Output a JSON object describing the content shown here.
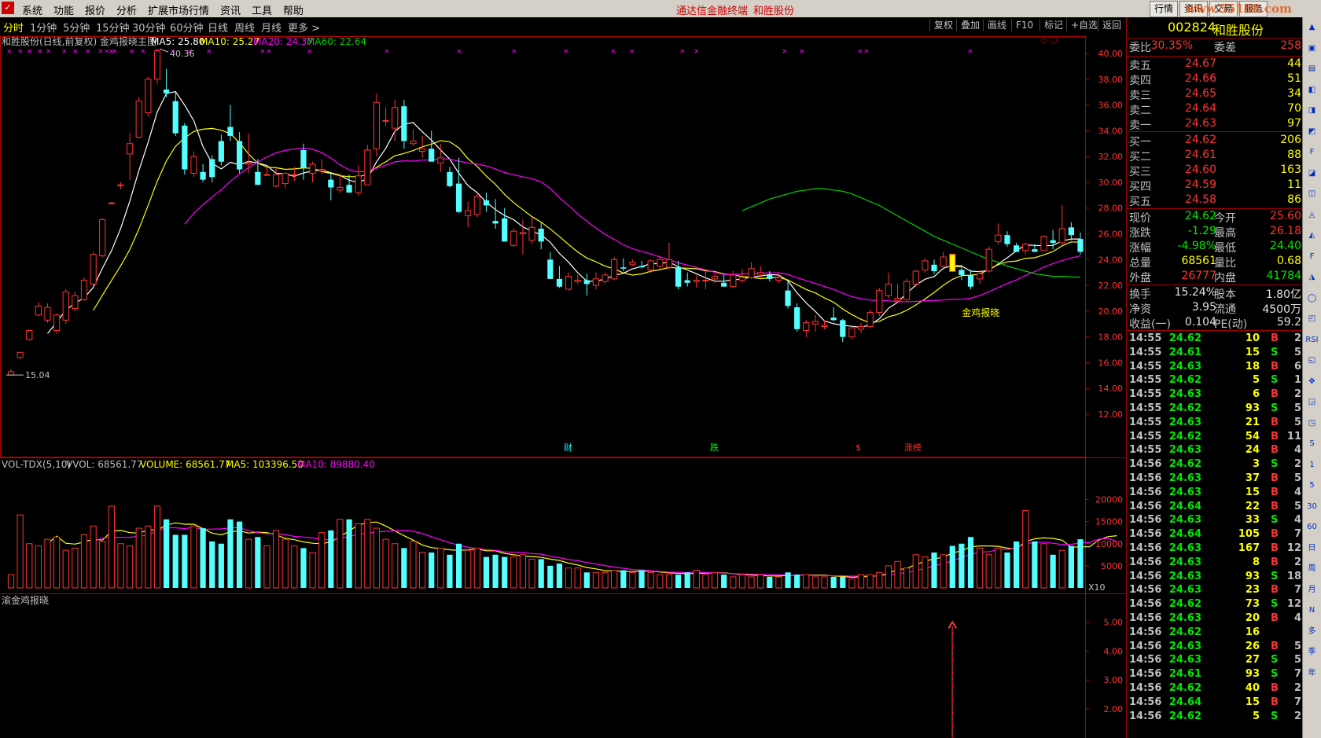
{
  "menubar": {
    "logo": "✓",
    "items": [
      "系统",
      "功能",
      "报价",
      "分析",
      "扩展市场行情",
      "资讯",
      "工具",
      "帮助"
    ],
    "center_app": "通达信金融终端",
    "center_stock": "和胜股份",
    "right_buttons": [
      "行情",
      "资讯",
      "交易",
      "服务"
    ],
    "watermark": "www.55188.com"
  },
  "tabs": {
    "periods": [
      "分时",
      "1分钟",
      "5分钟",
      "15分钟",
      "30分钟",
      "60分钟",
      "日线",
      "周线",
      "月线",
      "更多 >"
    ],
    "active": "日线",
    "tools": [
      "复权",
      "叠加",
      "画线",
      "F10",
      "标记",
      "+自选",
      "返回"
    ]
  },
  "kline": {
    "info_title": "和胜股份(日线,前复权) 金鸡报晓主图",
    "ma5": "MA5: 25.80",
    "ma10": "MA10: 25.27",
    "ma20": "MA20: 24.37",
    "ma60": "MA60: 22.64",
    "high_label": "40.36",
    "low_label": "15.04",
    "signal_label": "金鸡报晓",
    "event_labels": [
      "财",
      "跌",
      "$",
      "涨榜"
    ],
    "colors": {
      "up": "#ff3232",
      "down": "#54ffff",
      "ma5": "#ffffff",
      "ma10": "#ffff00",
      "ma20": "#ff00ff",
      "ma60": "#00d000",
      "signal": "#ffff00"
    }
  },
  "volume": {
    "title": "VOL-TDX(5,10)",
    "vvol": "VVOL: 68561.77",
    "volume": "VOLUME: 68561.77",
    "ma5": "MA5: 103396.50",
    "ma10": "MA10: 89880.40",
    "unit": "X10",
    "axis_labels": [
      "20000",
      "15000",
      "10000",
      "5000"
    ]
  },
  "indicator": {
    "title": "渝金鸡报晓",
    "axis_labels": [
      "5.00",
      "4.00",
      "3.00",
      "2.00"
    ]
  },
  "price_axis": [
    "40.00",
    "38.00",
    "36.00",
    "34.00",
    "32.00",
    "30.00",
    "28.00",
    "26.00",
    "24.00",
    "22.00",
    "20.00",
    "18.00",
    "16.00",
    "14.00",
    "12.00"
  ],
  "chart_data": [
    {
      "type": "candlestick",
      "title": "和胜股份(日线,前复权) 金鸡报晓主图",
      "y_range": [
        12,
        40.5
      ],
      "ohlc": [
        [
          15.04,
          15.5,
          15.04,
          15.3
        ],
        [
          16.4,
          16.8,
          16.3,
          16.8
        ],
        [
          17.8,
          18.5,
          17.7,
          18.5
        ],
        [
          19.7,
          20.7,
          19.6,
          20.4
        ],
        [
          19.3,
          20.6,
          19.1,
          20.3
        ],
        [
          18.5,
          19.8,
          18.3,
          19.7
        ],
        [
          19.3,
          21.7,
          19.0,
          21.5
        ],
        [
          20.2,
          21.5,
          20.0,
          21.2
        ],
        [
          20.9,
          22.6,
          20.8,
          22.4
        ],
        [
          22.1,
          24.6,
          22.0,
          24.4
        ],
        [
          24.3,
          27.2,
          24.2,
          27.1
        ],
        [
          28.4,
          28.5,
          28.3,
          28.4
        ],
        [
          29.8,
          30.0,
          29.5,
          29.8
        ],
        [
          32.2,
          33.8,
          30.2,
          33.0
        ],
        [
          33.5,
          36.6,
          33.4,
          36.3
        ],
        [
          35.4,
          38.2,
          35.1,
          38.0
        ],
        [
          38.0,
          40.36,
          37.6,
          40.2
        ],
        [
          37.2,
          38.8,
          36.6,
          36.9
        ],
        [
          36.3,
          37.0,
          33.6,
          33.8
        ],
        [
          34.4,
          34.6,
          30.6,
          31.0
        ],
        [
          30.7,
          32.4,
          30.4,
          32.0
        ],
        [
          30.8,
          31.4,
          30.0,
          30.2
        ],
        [
          31.8,
          32.1,
          30.0,
          30.4
        ],
        [
          33.2,
          33.7,
          31.3,
          31.6
        ],
        [
          34.3,
          36.0,
          33.2,
          33.6
        ],
        [
          33.2,
          33.9,
          30.7,
          31.0
        ],
        [
          31.4,
          33.8,
          30.7,
          31.5
        ],
        [
          30.8,
          31.8,
          29.8,
          29.8
        ],
        [
          30.6,
          31.1,
          30.6,
          30.6
        ],
        [
          29.7,
          31.1,
          29.6,
          30.6
        ],
        [
          29.9,
          30.8,
          29.5,
          30.7
        ],
        [
          30.6,
          31.2,
          30.1,
          30.6
        ],
        [
          32.5,
          33.0,
          30.2,
          31.1
        ],
        [
          30.7,
          31.6,
          30.0,
          31.4
        ],
        [
          30.9,
          31.8,
          30.6,
          31.0
        ],
        [
          30.2,
          30.7,
          28.6,
          29.6
        ],
        [
          29.4,
          30.7,
          29.2,
          29.6
        ],
        [
          29.8,
          30.6,
          29.4,
          29.2
        ],
        [
          29.2,
          31.3,
          29.0,
          30.5
        ],
        [
          29.8,
          32.9,
          29.8,
          32.5
        ],
        [
          32.6,
          36.9,
          32.0,
          36.2
        ],
        [
          34.8,
          35.8,
          34.4,
          34.8
        ],
        [
          34.2,
          36.4,
          33.2,
          35.8
        ],
        [
          35.9,
          36.4,
          32.6,
          33.2
        ],
        [
          33.0,
          34.1,
          32.8,
          33.2
        ],
        [
          32.4,
          33.6,
          31.9,
          32.6
        ],
        [
          32.6,
          34.0,
          32.0,
          31.6
        ],
        [
          31.5,
          33.0,
          30.8,
          31.9
        ],
        [
          30.8,
          31.2,
          29.6,
          29.7
        ],
        [
          29.9,
          31.9,
          27.6,
          27.7
        ],
        [
          27.4,
          28.5,
          26.5,
          27.8
        ],
        [
          27.5,
          29.2,
          27.3,
          28.9
        ],
        [
          28.6,
          29.2,
          27.7,
          28.2
        ],
        [
          27.0,
          28.7,
          26.4,
          26.8
        ],
        [
          27.2,
          28.0,
          25.4,
          25.4
        ],
        [
          25.1,
          26.4,
          25.0,
          26.2
        ],
        [
          26.0,
          27.1,
          24.4,
          26.1
        ],
        [
          25.5,
          27.3,
          25.2,
          26.5
        ],
        [
          26.4,
          26.9,
          24.8,
          25.4
        ],
        [
          24.0,
          24.6,
          22.6,
          22.5
        ],
        [
          22.5,
          23.5,
          21.8,
          21.9
        ],
        [
          21.7,
          23.0,
          21.6,
          22.7
        ],
        [
          22.3,
          22.8,
          22.1,
          22.4
        ],
        [
          22.4,
          22.9,
          21.2,
          22.1
        ],
        [
          22.0,
          23.0,
          21.7,
          22.5
        ],
        [
          22.3,
          23.0,
          22.1,
          22.8
        ],
        [
          22.5,
          24.2,
          22.4,
          24.0
        ],
        [
          23.4,
          24.1,
          23.1,
          23.3
        ],
        [
          23.6,
          24.0,
          23.5,
          23.8
        ],
        [
          23.5,
          23.9,
          23.3,
          23.4
        ],
        [
          23.2,
          24.0,
          23.0,
          23.9
        ],
        [
          23.5,
          24.3,
          23.3,
          24.0
        ],
        [
          23.4,
          25.3,
          23.2,
          24.0
        ],
        [
          23.4,
          23.9,
          21.7,
          21.9
        ],
        [
          22.4,
          23.0,
          21.9,
          22.2
        ],
        [
          22.3,
          22.8,
          21.8,
          22.4
        ],
        [
          22.4,
          23.1,
          21.7,
          22.4
        ],
        [
          22.5,
          22.9,
          22.2,
          22.7
        ],
        [
          22.2,
          22.8,
          22.0,
          21.9
        ],
        [
          21.9,
          23.1,
          21.8,
          22.8
        ],
        [
          22.4,
          23.3,
          22.2,
          22.6
        ],
        [
          22.6,
          23.8,
          22.5,
          23.3
        ],
        [
          22.8,
          23.5,
          22.6,
          23.0
        ],
        [
          22.8,
          23.1,
          22.3,
          22.5
        ],
        [
          22.4,
          23.0,
          22.2,
          22.6
        ],
        [
          21.6,
          22.3,
          20.2,
          20.4
        ],
        [
          20.3,
          20.6,
          18.4,
          18.6
        ],
        [
          18.5,
          19.3,
          18.0,
          19.1
        ],
        [
          19.0,
          19.7,
          18.4,
          19.2
        ],
        [
          18.8,
          19.3,
          18.6,
          18.9
        ],
        [
          19.5,
          20.3,
          19.2,
          19.3
        ],
        [
          19.3,
          19.4,
          17.6,
          18.0
        ],
        [
          18.0,
          18.9,
          17.8,
          18.7
        ],
        [
          18.6,
          19.1,
          18.3,
          18.8
        ],
        [
          18.8,
          20.1,
          18.7,
          19.9
        ],
        [
          19.9,
          21.8,
          19.6,
          21.6
        ],
        [
          21.2,
          23.0,
          21.0,
          22.1
        ],
        [
          20.8,
          22.1,
          20.6,
          21.0
        ],
        [
          20.9,
          22.5,
          20.8,
          22.3
        ],
        [
          22.1,
          23.2,
          21.9,
          23.1
        ],
        [
          23.2,
          24.1,
          23.0,
          23.9
        ],
        [
          23.6,
          24.0,
          22.9,
          23.1
        ],
        [
          23.5,
          24.6,
          23.4,
          24.2
        ],
        [
          24.1,
          24.3,
          23.2,
          23.5
        ],
        [
          23.2,
          23.6,
          22.4,
          22.8
        ],
        [
          22.8,
          23.2,
          21.7,
          21.9
        ],
        [
          22.5,
          23.2,
          22.1,
          22.9
        ],
        [
          23.1,
          25.0,
          23.0,
          24.8
        ],
        [
          25.4,
          26.8,
          25.2,
          25.9
        ],
        [
          25.9,
          26.2,
          25.0,
          25.2
        ],
        [
          25.1,
          25.3,
          24.6,
          24.6
        ],
        [
          24.7,
          25.3,
          24.4,
          25.2
        ],
        [
          24.8,
          25.2,
          24.6,
          24.6
        ],
        [
          24.7,
          25.9,
          24.7,
          25.8
        ],
        [
          25.5,
          26.3,
          24.8,
          25.3
        ],
        [
          25.3,
          28.2,
          25.2,
          26.4
        ],
        [
          26.5,
          26.9,
          25.5,
          25.9
        ],
        [
          25.6,
          26.1,
          24.4,
          24.6
        ]
      ],
      "signal_day_index": 103,
      "ma60_tail": [
        27.8,
        28.1,
        28.4,
        28.7,
        28.9,
        29.1,
        29.3,
        29.4,
        29.5,
        29.5,
        29.4,
        29.3,
        29.1,
        28.8,
        28.5,
        28.2,
        27.8,
        27.4,
        27.0,
        26.6,
        26.2,
        25.8,
        25.5,
        25.2,
        24.9,
        24.6,
        24.3,
        24.0,
        23.8,
        23.5,
        23.3,
        23.1,
        22.9,
        22.8,
        22.7,
        22.7,
        22.65,
        22.64
      ]
    },
    {
      "type": "bar",
      "title": "VOL-TDX(5,10)",
      "unit": "X10",
      "y_range": [
        0,
        24000
      ],
      "values": [
        3000,
        16500,
        10000,
        9500,
        11000,
        11500,
        8500,
        9000,
        12000,
        14000,
        10500,
        18500,
        10000,
        9500,
        13500,
        14000,
        18500,
        15500,
        12000,
        12000,
        14000,
        13500,
        10500,
        10000,
        15500,
        15000,
        11000,
        11500,
        9500,
        13000,
        11000,
        9500,
        9000,
        8000,
        12500,
        13000,
        15500,
        15500,
        14500,
        15500,
        13500,
        11000,
        10000,
        9000,
        10500,
        8000,
        8000,
        9000,
        7500,
        10000,
        8500,
        9000,
        7000,
        7500,
        7000,
        7000,
        7500,
        6500,
        6500,
        5000,
        5500,
        4500,
        4500,
        3500,
        3500,
        3500,
        4000,
        4000,
        3500,
        4000,
        3500,
        3000,
        3000,
        3000,
        3500,
        4000,
        3000,
        3500,
        3000,
        2500,
        3000,
        2500,
        3000,
        2500,
        2500,
        3500,
        3000,
        3000,
        2500,
        2500,
        2500,
        2500,
        2000,
        3000,
        3000,
        3500,
        5000,
        6000,
        4500,
        7500,
        7000,
        8000,
        7500,
        9500,
        10000,
        11500,
        9000,
        7500,
        9000,
        8000,
        10500,
        17500,
        10500,
        10000,
        7500,
        8500,
        9500,
        11000,
        10000,
        15000,
        12500,
        10500
      ],
      "ma5_scale_note": ""
    },
    {
      "type": "bar",
      "title": "渝金鸡报晓",
      "y_range": [
        1.0,
        5.5
      ],
      "signal_index": 103,
      "signal_value": 5.0
    }
  ],
  "quote": {
    "code": "002824",
    "name": "和胜股份",
    "weibi_label": "委比",
    "weibi": "30.35%",
    "weicha_label": "委差",
    "weicha": "258",
    "asks": [
      {
        "label": "卖五",
        "price": "24.67",
        "vol": "44"
      },
      {
        "label": "卖四",
        "price": "24.66",
        "vol": "51"
      },
      {
        "label": "卖三",
        "price": "24.65",
        "vol": "34"
      },
      {
        "label": "卖二",
        "price": "24.64",
        "vol": "70"
      },
      {
        "label": "卖一",
        "price": "24.63",
        "vol": "97"
      }
    ],
    "bids": [
      {
        "label": "买一",
        "price": "24.62",
        "vol": "206"
      },
      {
        "label": "买二",
        "price": "24.61",
        "vol": "88"
      },
      {
        "label": "买三",
        "price": "24.60",
        "vol": "163"
      },
      {
        "label": "买四",
        "price": "24.59",
        "vol": "11"
      },
      {
        "label": "买五",
        "price": "24.58",
        "vol": "86"
      }
    ],
    "stats": [
      {
        "l1": "现价",
        "v1": "24.62",
        "c1": "grn",
        "l2": "今开",
        "v2": "25.60",
        "c2": "red"
      },
      {
        "l1": "涨跌",
        "v1": "-1.29",
        "c1": "grn",
        "l2": "最高",
        "v2": "26.18",
        "c2": "red"
      },
      {
        "l1": "涨幅",
        "v1": "-4.98%",
        "c1": "grn",
        "l2": "最低",
        "v2": "24.40",
        "c2": "grn"
      },
      {
        "l1": "总量",
        "v1": "68561",
        "c1": "yel",
        "l2": "量比",
        "v2": "0.68",
        "c2": "yel"
      },
      {
        "l1": "外盘",
        "v1": "26777",
        "c1": "red",
        "l2": "内盘",
        "v2": "41784",
        "c2": "grn"
      }
    ],
    "stats2": [
      {
        "l1": "换手",
        "v1": "15.24%",
        "l2": "股本",
        "v2": "1.80亿"
      },
      {
        "l1": "净资",
        "v1": "3.95",
        "l2": "流通",
        "v2": "4500万"
      },
      {
        "l1": "收益(一)",
        "v1": "0.104",
        "l2": "PE(动)",
        "v2": "59.2"
      }
    ]
  },
  "ticks": [
    [
      "14:55",
      "24.62",
      "10",
      "B",
      "2"
    ],
    [
      "14:55",
      "24.61",
      "15",
      "S",
      "5"
    ],
    [
      "14:55",
      "24.63",
      "18",
      "B",
      "6"
    ],
    [
      "14:55",
      "24.62",
      "5",
      "S",
      "1"
    ],
    [
      "14:55",
      "24.63",
      "6",
      "B",
      "2"
    ],
    [
      "14:55",
      "24.62",
      "93",
      "S",
      "5"
    ],
    [
      "14:55",
      "24.63",
      "21",
      "B",
      "5"
    ],
    [
      "14:55",
      "24.62",
      "54",
      "B",
      "11"
    ],
    [
      "14:55",
      "24.63",
      "24",
      "B",
      "4"
    ],
    [
      "14:56",
      "24.62",
      "3",
      "S",
      "2"
    ],
    [
      "14:56",
      "24.63",
      "37",
      "B",
      "5"
    ],
    [
      "14:56",
      "24.63",
      "15",
      "B",
      "4"
    ],
    [
      "14:56",
      "24.64",
      "22",
      "B",
      "5"
    ],
    [
      "14:56",
      "24.63",
      "33",
      "S",
      "4"
    ],
    [
      "14:56",
      "24.64",
      "105",
      "B",
      "7"
    ],
    [
      "14:56",
      "24.63",
      "167",
      "B",
      "12"
    ],
    [
      "14:56",
      "24.63",
      "8",
      "B",
      "2"
    ],
    [
      "14:56",
      "24.63",
      "93",
      "S",
      "18"
    ],
    [
      "14:56",
      "24.63",
      "23",
      "B",
      "7"
    ],
    [
      "14:56",
      "24.62",
      "73",
      "S",
      "12"
    ],
    [
      "14:56",
      "24.63",
      "20",
      "B",
      "4"
    ],
    [
      "14:56",
      "24.62",
      "16",
      "",
      ""
    ],
    [
      "14:56",
      "24.63",
      "26",
      "B",
      "5"
    ],
    [
      "14:56",
      "24.63",
      "27",
      "S",
      "5"
    ],
    [
      "14:56",
      "24.61",
      "93",
      "S",
      "7"
    ],
    [
      "14:56",
      "24.62",
      "40",
      "B",
      "2"
    ],
    [
      "14:56",
      "24.64",
      "15",
      "B",
      "7"
    ],
    [
      "14:56",
      "24.62",
      "5",
      "S",
      "2"
    ]
  ],
  "side_icons": [
    "▲",
    "▣",
    "▤",
    "◧",
    "◨",
    "◩",
    "F",
    "◪",
    "◫",
    "◬",
    "◭",
    "F",
    "◮",
    "◯",
    "◰",
    "RSI",
    "◱",
    "✥",
    "◲",
    "◳",
    "S",
    "1",
    "5",
    "30",
    "60",
    "日",
    "周",
    "月",
    "N",
    "多",
    "季",
    "年"
  ]
}
